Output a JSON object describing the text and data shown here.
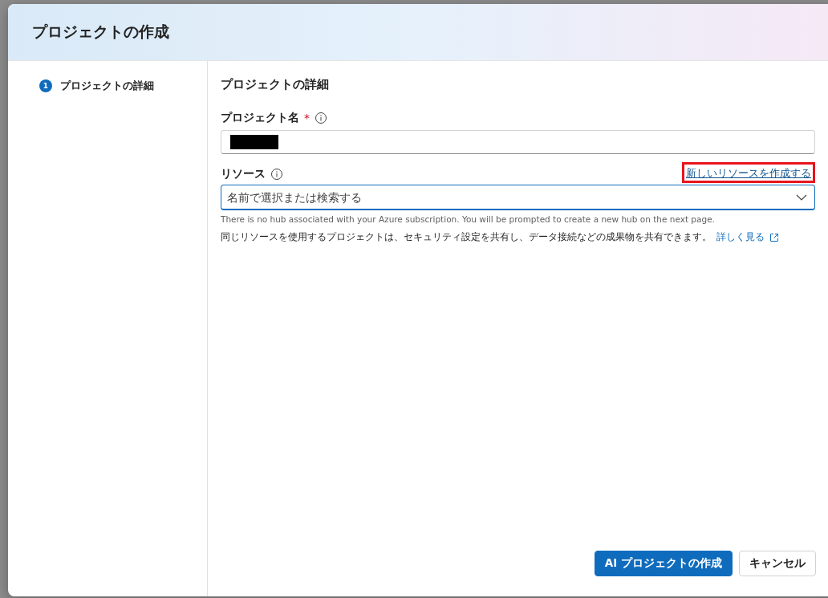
{
  "dialog": {
    "title": "プロジェクトの作成"
  },
  "steps": [
    {
      "number": "1",
      "label": "プロジェクトの詳細",
      "selected": true
    }
  ],
  "section_title": "プロジェクトの詳細",
  "project_name": {
    "label": "プロジェクト名",
    "required_mark": "*",
    "redacted": true
  },
  "resource": {
    "label": "リソース",
    "create_link": {
      "text": "新しいリソースを作成する",
      "highlighted": true
    },
    "placeholder": "名前で選択または検索する",
    "focused": true,
    "hint": "There is no hub associated with your Azure subscription. You will be prompted to create a new hub on the next page."
  },
  "description": {
    "text": "同じリソースを使用するプロジェクトは、セキュリティ設定を共有し、データ接続などの成果物を共有できます。",
    "link": "詳しく見る"
  },
  "buttons": [
    {
      "kind": "primary",
      "label": "AI プロジェクトの作成"
    },
    {
      "kind": "secondary",
      "label": "キャンセル"
    }
  ]
}
